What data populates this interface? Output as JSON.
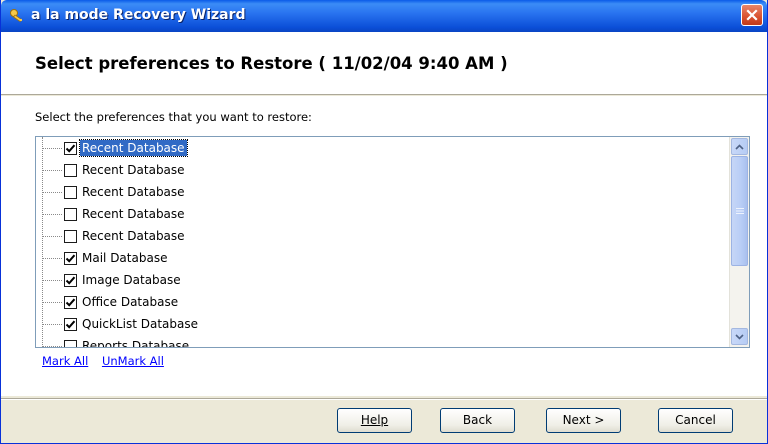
{
  "window": {
    "title": "a la mode Recovery Wizard"
  },
  "header": {
    "heading": "Select preferences to Restore ( 11/02/04 9:40 AM )"
  },
  "body": {
    "instruction": "Select the preferences that you want to restore:",
    "items": [
      {
        "label": "Recent Database",
        "checked": true,
        "selected": true
      },
      {
        "label": "Recent Database",
        "checked": false,
        "selected": false
      },
      {
        "label": "Recent Database",
        "checked": false,
        "selected": false
      },
      {
        "label": "Recent Database",
        "checked": false,
        "selected": false
      },
      {
        "label": "Recent Database",
        "checked": false,
        "selected": false
      },
      {
        "label": "Mail Database",
        "checked": true,
        "selected": false
      },
      {
        "label": "Image Database",
        "checked": true,
        "selected": false
      },
      {
        "label": "Office Database",
        "checked": true,
        "selected": false
      },
      {
        "label": "QuickList Database",
        "checked": true,
        "selected": false
      },
      {
        "label": "Reports Database",
        "checked": false,
        "selected": false
      }
    ],
    "mark_all": "Mark All",
    "unmark_all": "UnMark All"
  },
  "footer": {
    "help_label": "Help",
    "back_label": "Back",
    "next_label": "Next >",
    "cancel_label": "Cancel"
  },
  "colors": {
    "titlebar": "#0a5ae8",
    "selection": "#316ac5",
    "link": "#0000ff"
  }
}
